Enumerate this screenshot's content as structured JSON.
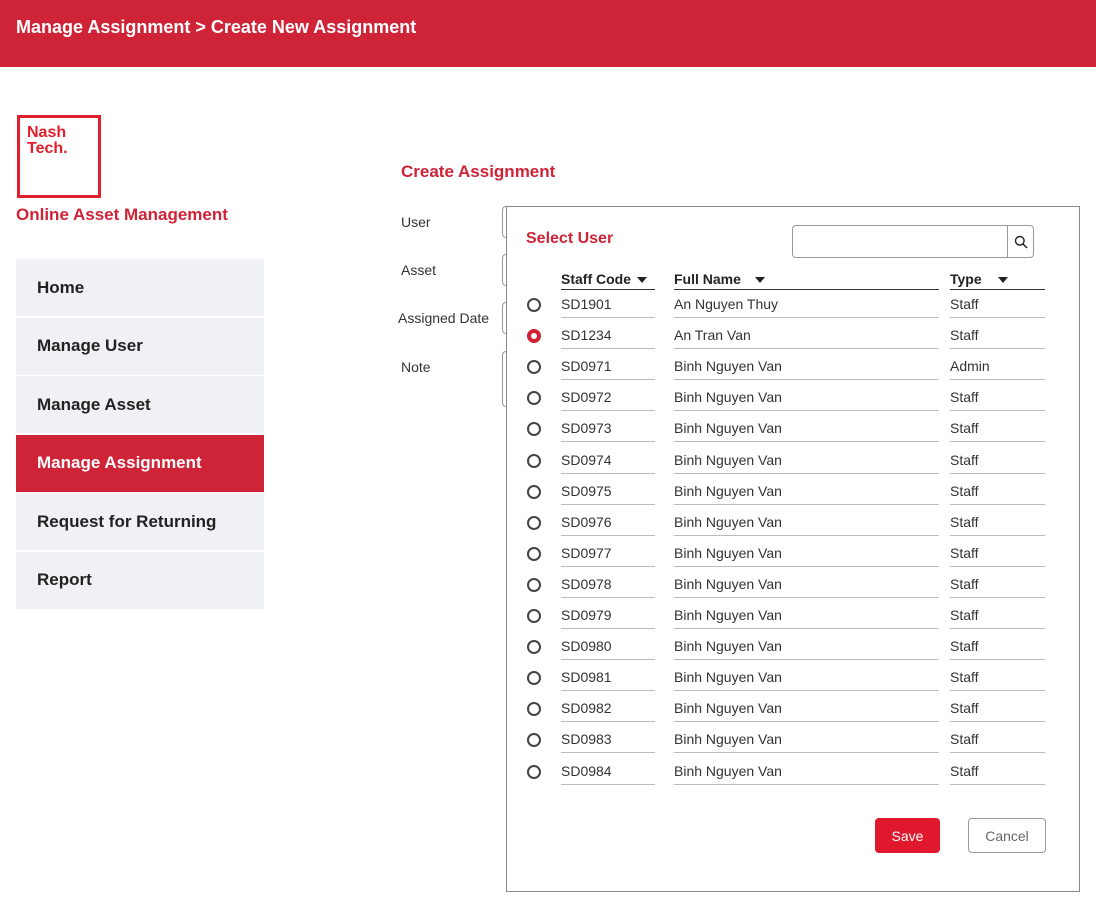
{
  "header": {
    "breadcrumb": "Manage Assignment > Create New Assignment"
  },
  "brand": {
    "logo_text_line1": "Nash",
    "logo_text_line2": "Tech.",
    "app_name": "Online Asset Management"
  },
  "nav": {
    "items": [
      {
        "label": "Home",
        "active": false
      },
      {
        "label": "Manage User",
        "active": false
      },
      {
        "label": "Manage Asset",
        "active": false
      },
      {
        "label": "Manage Assignment",
        "active": true
      },
      {
        "label": "Request for Returning",
        "active": false
      },
      {
        "label": "Report",
        "active": false
      }
    ]
  },
  "form": {
    "title": "Create Assignment",
    "labels": {
      "user": "User",
      "asset": "Asset",
      "assigned_date": "Assigned Date",
      "note": "Note"
    }
  },
  "popup": {
    "title": "Select User",
    "search": {
      "value": "",
      "placeholder": "",
      "icon": "search-icon"
    },
    "columns": {
      "staff_code": "Staff Code",
      "full_name": "Full Name",
      "type": "Type"
    },
    "rows": [
      {
        "staff_code": "SD1901",
        "full_name": "An Nguyen Thuy",
        "type": "Staff",
        "selected": false
      },
      {
        "staff_code": "SD1234",
        "full_name": "An Tran Van",
        "type": "Staff",
        "selected": true
      },
      {
        "staff_code": "SD0971",
        "full_name": "Binh Nguyen Van",
        "type": "Admin",
        "selected": false
      },
      {
        "staff_code": "SD0972",
        "full_name": "Binh Nguyen Van",
        "type": "Staff",
        "selected": false
      },
      {
        "staff_code": "SD0973",
        "full_name": "Binh Nguyen Van",
        "type": "Staff",
        "selected": false
      },
      {
        "staff_code": "SD0974",
        "full_name": "Binh Nguyen Van",
        "type": "Staff",
        "selected": false
      },
      {
        "staff_code": "SD0975",
        "full_name": "Binh Nguyen Van",
        "type": "Staff",
        "selected": false
      },
      {
        "staff_code": "SD0976",
        "full_name": "Binh Nguyen Van",
        "type": "Staff",
        "selected": false
      },
      {
        "staff_code": "SD0977",
        "full_name": "Binh Nguyen Van",
        "type": "Staff",
        "selected": false
      },
      {
        "staff_code": "SD0978",
        "full_name": "Binh Nguyen Van",
        "type": "Staff",
        "selected": false
      },
      {
        "staff_code": "SD0979",
        "full_name": "Binh Nguyen Van",
        "type": "Staff",
        "selected": false
      },
      {
        "staff_code": "SD0980",
        "full_name": "Binh Nguyen Van",
        "type": "Staff",
        "selected": false
      },
      {
        "staff_code": "SD0981",
        "full_name": "Binh Nguyen Van",
        "type": "Staff",
        "selected": false
      },
      {
        "staff_code": "SD0982",
        "full_name": "Binh Nguyen Van",
        "type": "Staff",
        "selected": false
      },
      {
        "staff_code": "SD0983",
        "full_name": "Binh Nguyen Van",
        "type": "Staff",
        "selected": false
      },
      {
        "staff_code": "SD0984",
        "full_name": "Binh Nguyen Van",
        "type": "Staff",
        "selected": false
      }
    ],
    "save_label": "Save",
    "cancel_label": "Cancel"
  },
  "colors": {
    "brand_red": "#cf2338",
    "save_red": "#e0182d",
    "nav_bg": "#eff1f5"
  }
}
